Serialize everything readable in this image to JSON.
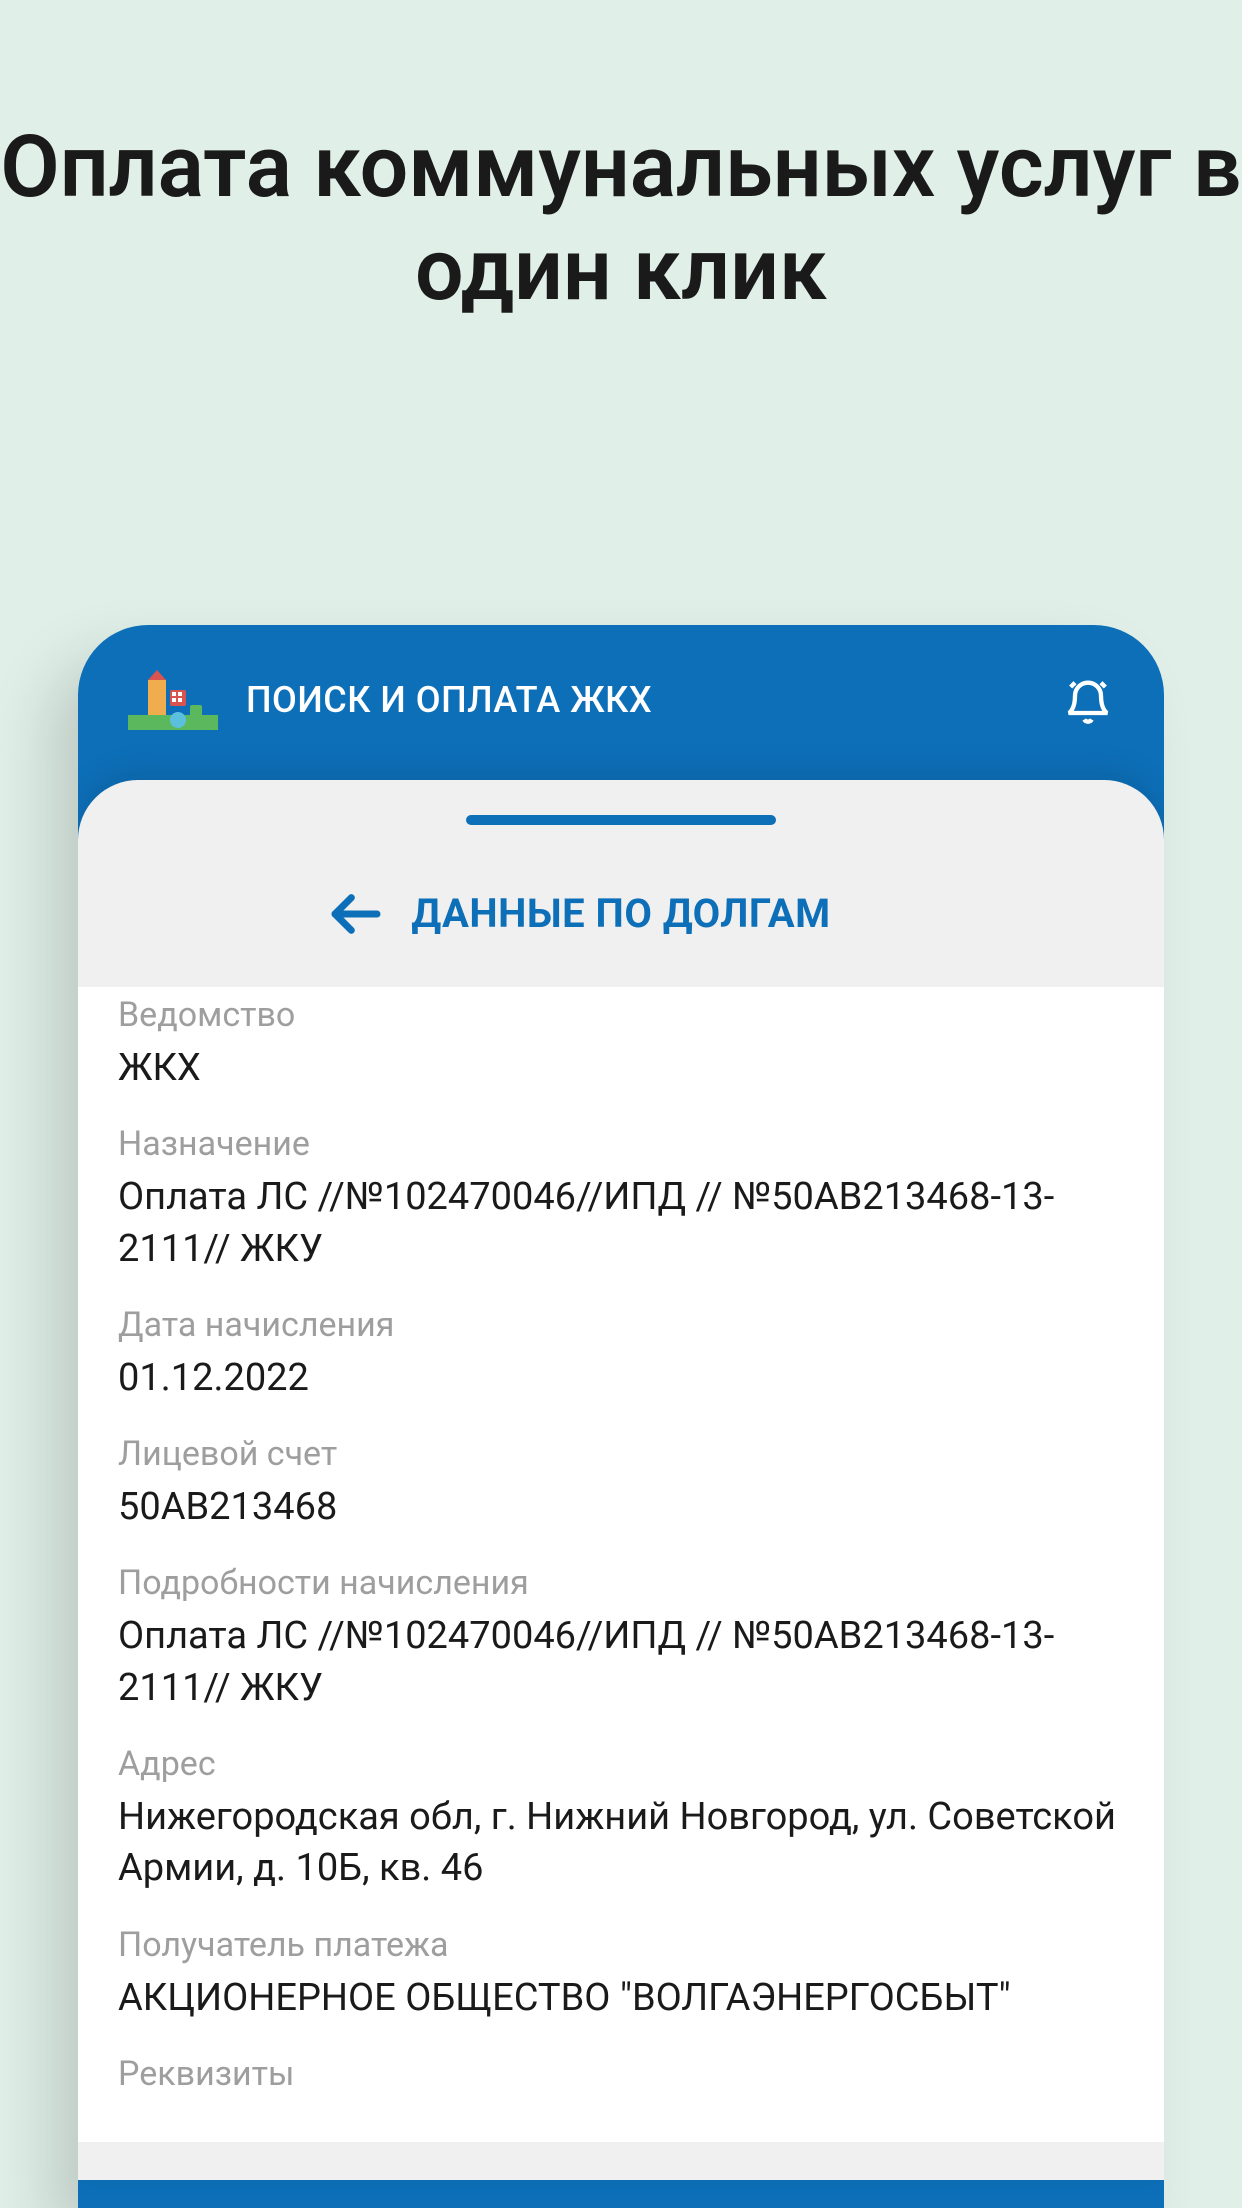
{
  "promo": {
    "title": "Оплата коммунальных услуг в один клик"
  },
  "header": {
    "title": "ПОИСК И ОПЛАТА ЖКХ"
  },
  "sheet": {
    "title": "ДАННЫЕ ПО ДОЛГАМ"
  },
  "fields": {
    "department": {
      "label": "Ведомство",
      "value": "ЖКХ"
    },
    "purpose": {
      "label": "Назначение",
      "value": "Оплата ЛС  //№102470046//ИПД // №50АВ213468-13-2111// ЖКУ"
    },
    "accrual_date": {
      "label": "Дата начисления",
      "value": "01.12.2022"
    },
    "account": {
      "label": "Лицевой счет",
      "value": "50АВ213468"
    },
    "accrual_details": {
      "label": "Подробности начисления",
      "value": "Оплата ЛС  //№102470046//ИПД // №50АВ213468-13-2111// ЖКУ"
    },
    "address": {
      "label": "Адрес",
      "value": "Нижегородская обл, г. Нижний Новгород, ул. Советской Армии, д. 10Б, кв. 46"
    },
    "recipient": {
      "label": "Получатель платежа",
      "value": "АКЦИОНЕРНОЕ ОБЩЕСТВО \"ВОЛГАЭНЕРГОСБЫТ\""
    },
    "requisites": {
      "label": "Реквизиты",
      "value": ""
    }
  }
}
